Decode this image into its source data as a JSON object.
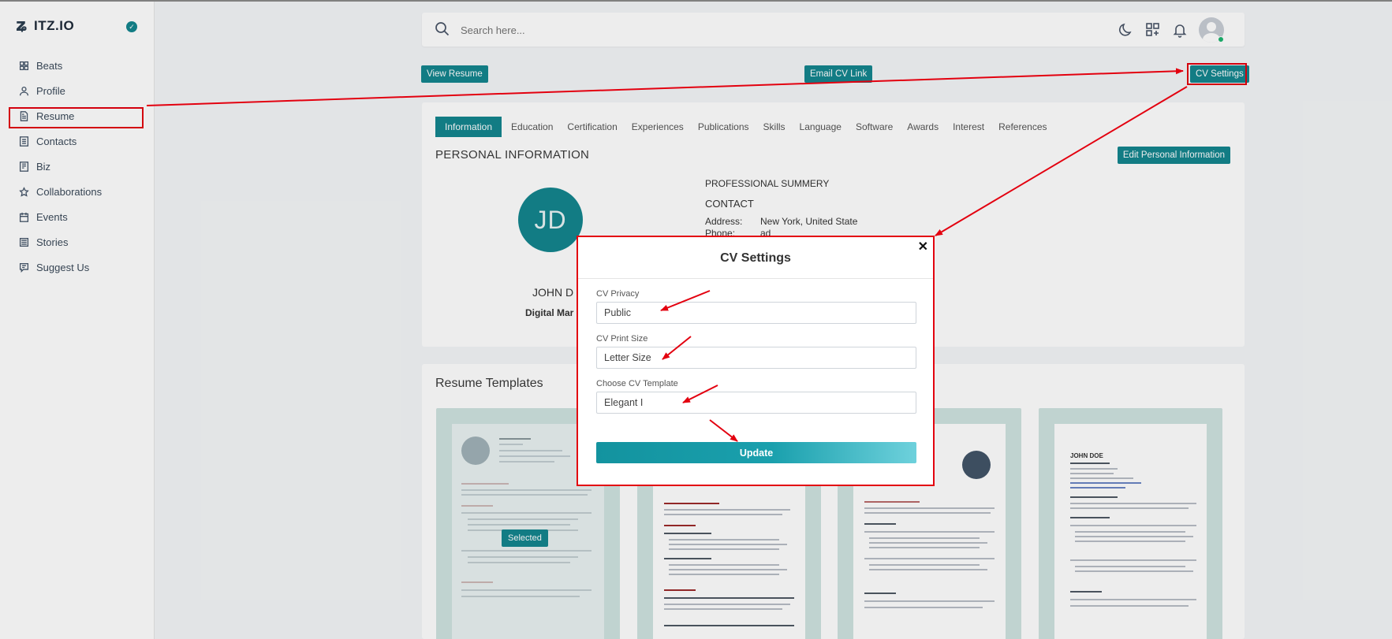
{
  "app": {
    "name": "ITZ.IO"
  },
  "sidebar": {
    "items": [
      {
        "label": "Beats",
        "icon": "grid-icon"
      },
      {
        "label": "Profile",
        "icon": "user-icon"
      },
      {
        "label": "Resume",
        "icon": "document-icon"
      },
      {
        "label": "Contacts",
        "icon": "contacts-icon"
      },
      {
        "label": "Biz",
        "icon": "briefcase-icon"
      },
      {
        "label": "Collaborations",
        "icon": "collaboration-icon"
      },
      {
        "label": "Events",
        "icon": "calendar-icon"
      },
      {
        "label": "Stories",
        "icon": "list-icon"
      },
      {
        "label": "Suggest Us",
        "icon": "message-icon"
      }
    ]
  },
  "header": {
    "search_placeholder": "Search here..."
  },
  "actions": {
    "view_resume": "View Resume",
    "email_cv_link": "Email CV Link",
    "cv_settings": "CV Settings"
  },
  "tabs": [
    "Information",
    "Education",
    "Certification",
    "Experiences",
    "Publications",
    "Skills",
    "Language",
    "Software",
    "Awards",
    "Interest",
    "References"
  ],
  "personal": {
    "title": "PERSONAL INFORMATION",
    "edit_button": "Edit Personal Information",
    "initials": "JD",
    "name": "JOHN D",
    "role": "Digital Mar",
    "summary_title": "PROFESSIONAL SUMMERY",
    "contact_title": "CONTACT",
    "address_label": "Address:",
    "address_value": "New York, United State",
    "phone_label": "Phone:",
    "phone_value": "ad"
  },
  "templates": {
    "title": "Resume Templates",
    "selected_label": "Selected"
  },
  "modal": {
    "title": "CV Settings",
    "close": "✕",
    "privacy_label": "CV Privacy",
    "privacy_value": "Public",
    "print_label": "CV Print Size",
    "print_value": "Letter Size",
    "template_label": "Choose CV Template",
    "template_value": "Elegant I",
    "update_button": "Update"
  },
  "colors": {
    "accent": "#14868f",
    "highlight": "#e3000f"
  }
}
